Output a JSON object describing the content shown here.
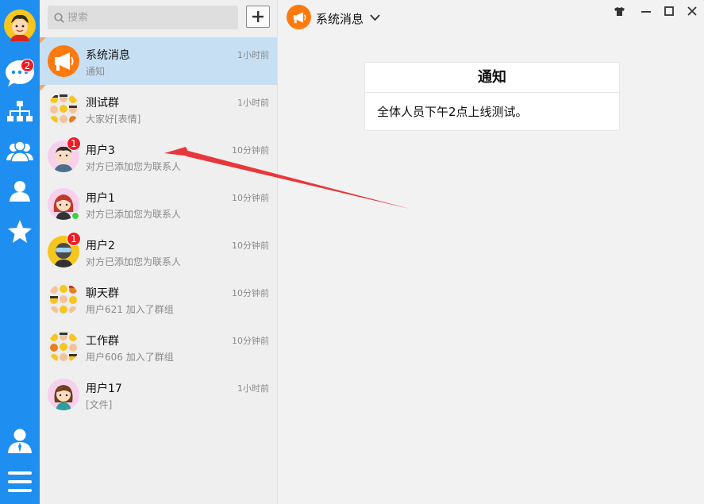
{
  "rail": {
    "chat_badge": "2",
    "icons": [
      "avatar-icon",
      "chat-icon",
      "org-tree-icon",
      "group-icon",
      "contact-icon",
      "star-icon",
      "user-profile-icon",
      "menu-icon"
    ],
    "accent": "#1e8ff0"
  },
  "search": {
    "placeholder": "搜索"
  },
  "conversations": [
    {
      "name": "系统消息",
      "message": "通知",
      "time": "1小时前",
      "active": true
    },
    {
      "name": "测试群",
      "message": "大家好[表情]",
      "time": "1小时前"
    },
    {
      "name": "用户3",
      "message": "对方已添加您为联系人",
      "time": "10分钟前",
      "badge": "1"
    },
    {
      "name": "用户1",
      "message": "对方已添加您为联系人",
      "time": "10分钟前",
      "online": true
    },
    {
      "name": "用户2",
      "message": "对方已添加您为联系人",
      "time": "10分钟前",
      "badge": "1"
    },
    {
      "name": "聊天群",
      "message": "用户621 加入了群组",
      "time": "10分钟前"
    },
    {
      "name": "工作群",
      "message": "用户606 加入了群组",
      "time": "10分钟前"
    },
    {
      "name": "用户17",
      "message": "[文件]",
      "time": "1小时前"
    }
  ],
  "chat": {
    "title": "系统消息",
    "notice_title": "通知",
    "notice_body": "全体人员下午2点上线测试。"
  },
  "colors": {
    "badge": "#ee1c25",
    "active_row": "#c7dff3",
    "system_orange": "#ff7a0e",
    "annotation_arrow": "#e8373a",
    "online": "#3cd23c"
  }
}
